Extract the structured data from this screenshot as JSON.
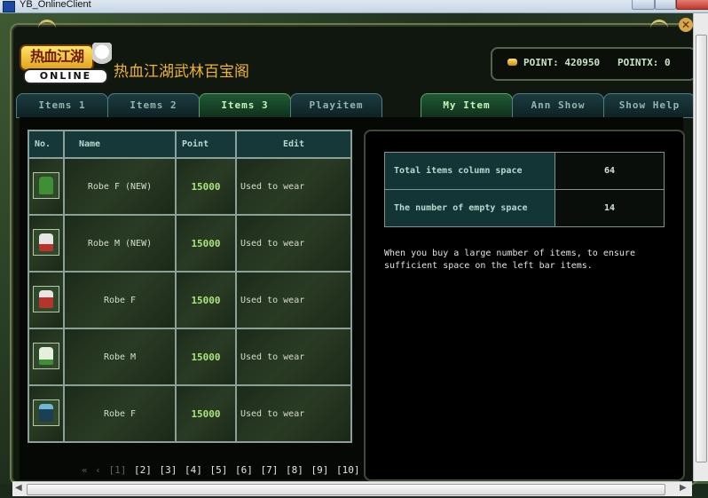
{
  "window": {
    "title": "YB_OnlineClient"
  },
  "header": {
    "logo_text": "热血江湖",
    "logo_sub": "ONLINE",
    "site_title": "热血江湖武林百宝阁",
    "point_label": "POINT:",
    "point_value": "420950",
    "pointx_label": "POINTX:",
    "pointx_value": "0"
  },
  "tabs_left": [
    {
      "label": "Items 1",
      "active": false
    },
    {
      "label": "Items 2",
      "active": false
    },
    {
      "label": "Items 3",
      "active": true
    },
    {
      "label": "Playitem",
      "active": false
    }
  ],
  "tabs_right": [
    {
      "label": "My Item",
      "active": true
    },
    {
      "label": "Ann Show",
      "active": false
    },
    {
      "label": "Show Help",
      "active": false
    }
  ],
  "table": {
    "headers": {
      "no": "No.",
      "name": "Name",
      "point": "Point",
      "edit": "Edit"
    },
    "rows": [
      {
        "icon": "robe-green-icon",
        "color": "#3f8f34",
        "name": "Robe F (NEW)",
        "point": "15000",
        "edit": "Used to wear"
      },
      {
        "icon": "robe-white-red-icon",
        "color": "#d9d9d9",
        "name": "Robe M (NEW)",
        "point": "15000",
        "edit": "Used to wear"
      },
      {
        "icon": "robe-red-icon",
        "color": "#b8332b",
        "name": "Robe F",
        "point": "15000",
        "edit": "Used to wear"
      },
      {
        "icon": "robe-white-green-icon",
        "color": "#cfe3c2",
        "name": "Robe M",
        "point": "15000",
        "edit": "Used to wear"
      },
      {
        "icon": "robe-dark-teal-icon",
        "color": "#1c3f55",
        "name": "Robe F",
        "point": "15000",
        "edit": "Used to wear"
      }
    ]
  },
  "pager": {
    "first": "«",
    "prev": "‹",
    "current": "[1]",
    "pages": [
      "[2]",
      "[3]",
      "[4]",
      "[5]",
      "[6]",
      "[7]",
      "[8]",
      "[9]",
      "[10]"
    ],
    "more": "...",
    "next": "›",
    "last": "»"
  },
  "info": {
    "rows": [
      {
        "label": "Total items column space",
        "value": "64"
      },
      {
        "label": "The number of empty space",
        "value": "14"
      }
    ],
    "note": "When you buy a large number of items, to ensure sufficient space on the left bar items."
  }
}
